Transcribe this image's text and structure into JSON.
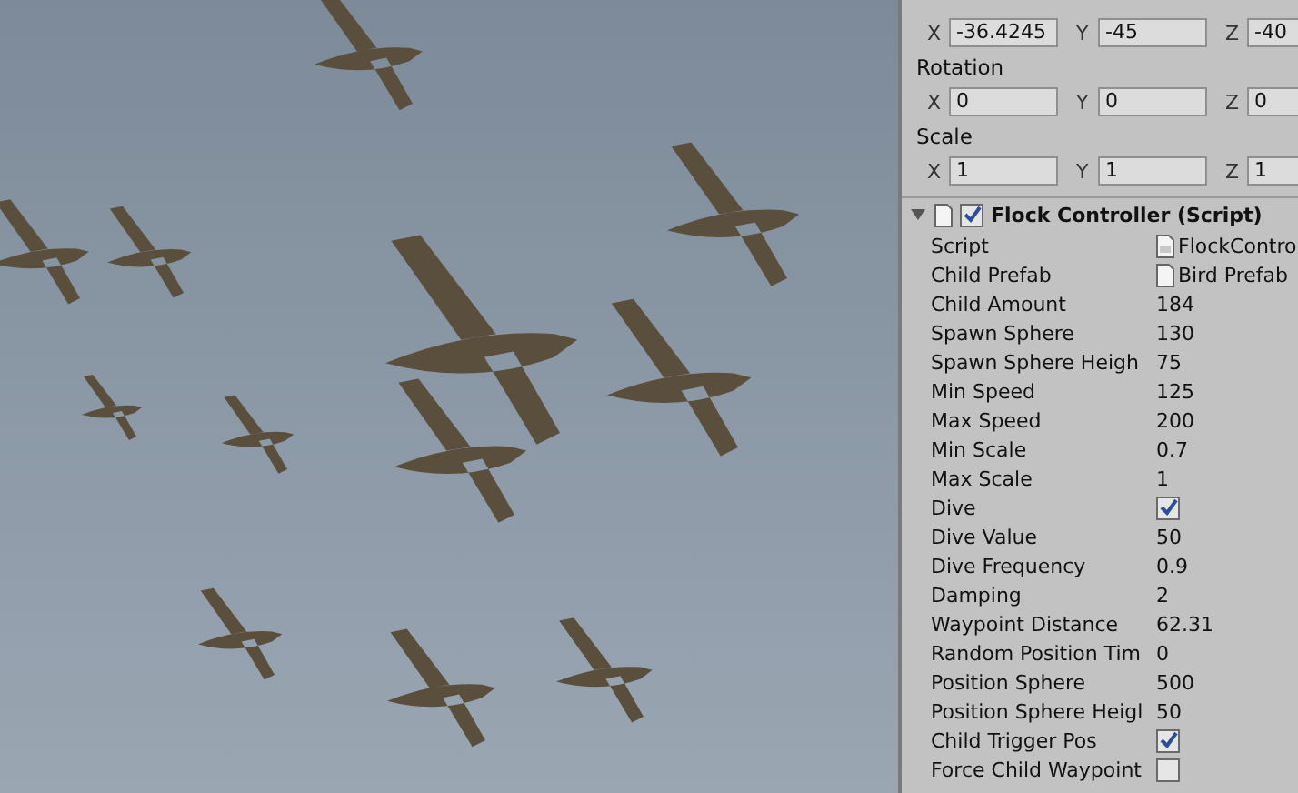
{
  "transform": [
    {
      "fields": [
        {
          "axis": "X",
          "value": "-36.4245"
        },
        {
          "axis": "Y",
          "value": "-45"
        },
        {
          "axis": "Z",
          "value": "-40"
        }
      ]
    },
    {
      "label": "Rotation",
      "fields": [
        {
          "axis": "X",
          "value": "0"
        },
        {
          "axis": "Y",
          "value": "0"
        },
        {
          "axis": "Z",
          "value": "0"
        }
      ]
    },
    {
      "label": "Scale",
      "fields": [
        {
          "axis": "X",
          "value": "1"
        },
        {
          "axis": "Y",
          "value": "1"
        },
        {
          "axis": "Z",
          "value": "1"
        }
      ]
    }
  ],
  "component": {
    "title": "Flock Controller (Script)",
    "expanded": true,
    "enabled": true,
    "properties": [
      {
        "kind": "script",
        "label": "Script",
        "value": "FlockContro"
      },
      {
        "kind": "object",
        "label": "Child Prefab",
        "value": "Bird Prefab"
      },
      {
        "kind": "text",
        "label": "Child Amount",
        "value": "184"
      },
      {
        "kind": "text",
        "label": "Spawn Sphere",
        "value": "130"
      },
      {
        "kind": "text",
        "label": "Spawn Sphere Heigh",
        "value": "75"
      },
      {
        "kind": "text",
        "label": "Min Speed",
        "value": "125"
      },
      {
        "kind": "text",
        "label": "Max Speed",
        "value": "200"
      },
      {
        "kind": "text",
        "label": "Min Scale",
        "value": "0.7"
      },
      {
        "kind": "text",
        "label": "Max Scale",
        "value": "1"
      },
      {
        "kind": "checkbox",
        "label": "Dive",
        "checked": true
      },
      {
        "kind": "text",
        "label": "Dive Value",
        "value": "50"
      },
      {
        "kind": "text",
        "label": "Dive Frequency",
        "value": "0.9"
      },
      {
        "kind": "text",
        "label": "Damping",
        "value": "2"
      },
      {
        "kind": "text",
        "label": "Waypoint Distance",
        "value": "62.31"
      },
      {
        "kind": "text",
        "label": "Random Position Tim",
        "value": "0"
      },
      {
        "kind": "text",
        "label": "Position Sphere",
        "value": "500"
      },
      {
        "kind": "text",
        "label": "Position Sphere Heigl",
        "value": "50"
      },
      {
        "kind": "checkbox",
        "label": "Child Trigger Pos",
        "checked": true
      },
      {
        "kind": "checkbox",
        "label": "Force Child Waypoint",
        "checked": false
      }
    ]
  }
}
